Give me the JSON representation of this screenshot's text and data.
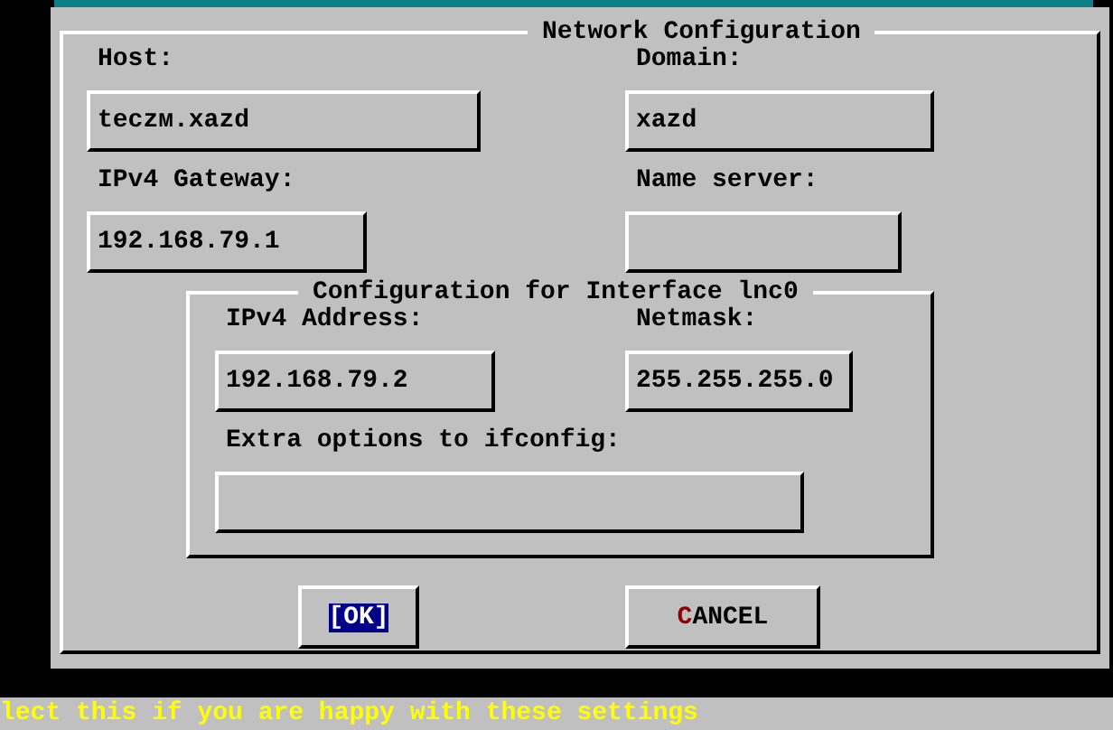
{
  "dialog": {
    "title": "Network Configuration",
    "fields": [
      {
        "label": "Host:",
        "value": "teczм.xazd"
      },
      {
        "label": "Domain:",
        "value": "xazd"
      },
      {
        "label": "IPv4 Gateway:",
        "value": "192.168.79.1"
      },
      {
        "label": "Name server:"
      }
    ],
    "interface": {
      "title": "Configuration for Interface lnc0",
      "fields": [
        {
          "label": "IPv4 Address:",
          "value": "192.168.79.2"
        },
        {
          "label": "Netmask:",
          "value": "255.255.255.0"
        },
        {
          "label": "Extra options to ifconfig:"
        }
      ]
    },
    "buttons": [
      {
        "label": "[OK]",
        "selected": true
      },
      {
        "label": "CANCEL",
        "selected": false
      }
    ]
  },
  "status_bar": "lect this if you are happy with these settings"
}
